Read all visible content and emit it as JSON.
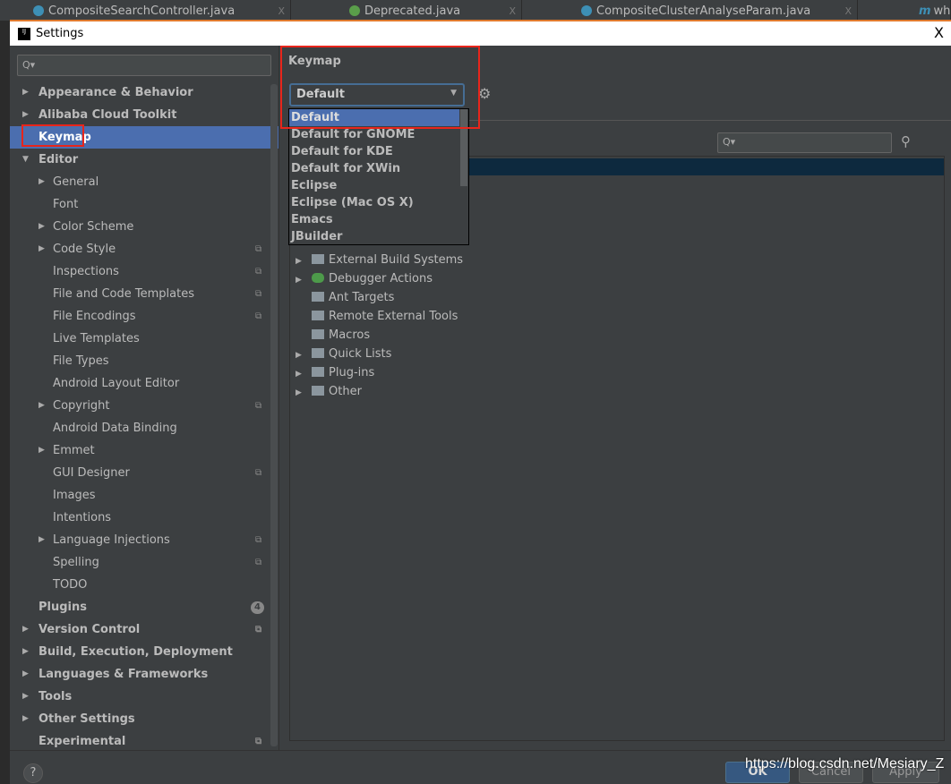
{
  "editor_tabs": [
    {
      "label": "CompositeSearchController.java"
    },
    {
      "label": "Deprecated.java"
    },
    {
      "label": "CompositeClusterAnalyseParam.java"
    },
    {
      "label": "wh"
    }
  ],
  "dialog": {
    "title": "Settings",
    "close": "X"
  },
  "sidebar": {
    "search_placeholder": "Q▾",
    "items": [
      {
        "label": "Appearance & Behavior"
      },
      {
        "label": "Alibaba Cloud Toolkit"
      },
      {
        "label": "Keymap"
      },
      {
        "label": "Editor"
      },
      {
        "label": "General"
      },
      {
        "label": "Font"
      },
      {
        "label": "Color Scheme"
      },
      {
        "label": "Code Style"
      },
      {
        "label": "Inspections"
      },
      {
        "label": "File and Code Templates"
      },
      {
        "label": "File Encodings"
      },
      {
        "label": "Live Templates"
      },
      {
        "label": "File Types"
      },
      {
        "label": "Android Layout Editor"
      },
      {
        "label": "Copyright"
      },
      {
        "label": "Android Data Binding"
      },
      {
        "label": "Emmet"
      },
      {
        "label": "GUI Designer"
      },
      {
        "label": "Images"
      },
      {
        "label": "Intentions"
      },
      {
        "label": "Language Injections"
      },
      {
        "label": "Spelling"
      },
      {
        "label": "TODO"
      },
      {
        "label": "Plugins",
        "badge": "4"
      },
      {
        "label": "Version Control"
      },
      {
        "label": "Build, Execution, Deployment"
      },
      {
        "label": "Languages & Frameworks"
      },
      {
        "label": "Tools"
      },
      {
        "label": "Other Settings"
      },
      {
        "label": "Experimental"
      }
    ]
  },
  "keymap": {
    "title": "Keymap",
    "selected": "Default",
    "search_placeholder": "Q▾",
    "options": [
      "Default",
      "Default for GNOME",
      "Default for KDE",
      "Default for XWin",
      "Eclipse",
      "Eclipse (Mac OS X)",
      "Emacs",
      "JBuilder"
    ],
    "tree": [
      {
        "label": "External Build Systems"
      },
      {
        "label": "Debugger Actions"
      },
      {
        "label": "Ant Targets"
      },
      {
        "label": "Remote External Tools"
      },
      {
        "label": "Macros"
      },
      {
        "label": "Quick Lists"
      },
      {
        "label": "Plug-ins"
      },
      {
        "label": "Other"
      }
    ]
  },
  "footer": {
    "help": "?",
    "ok": "OK",
    "cancel": "Cancel",
    "apply": "Apply"
  },
  "watermark": "https://blog.csdn.net/Mesiary_Z",
  "colors": {
    "selection": "#4b6eaf",
    "highlight_box": "#e8251b"
  }
}
